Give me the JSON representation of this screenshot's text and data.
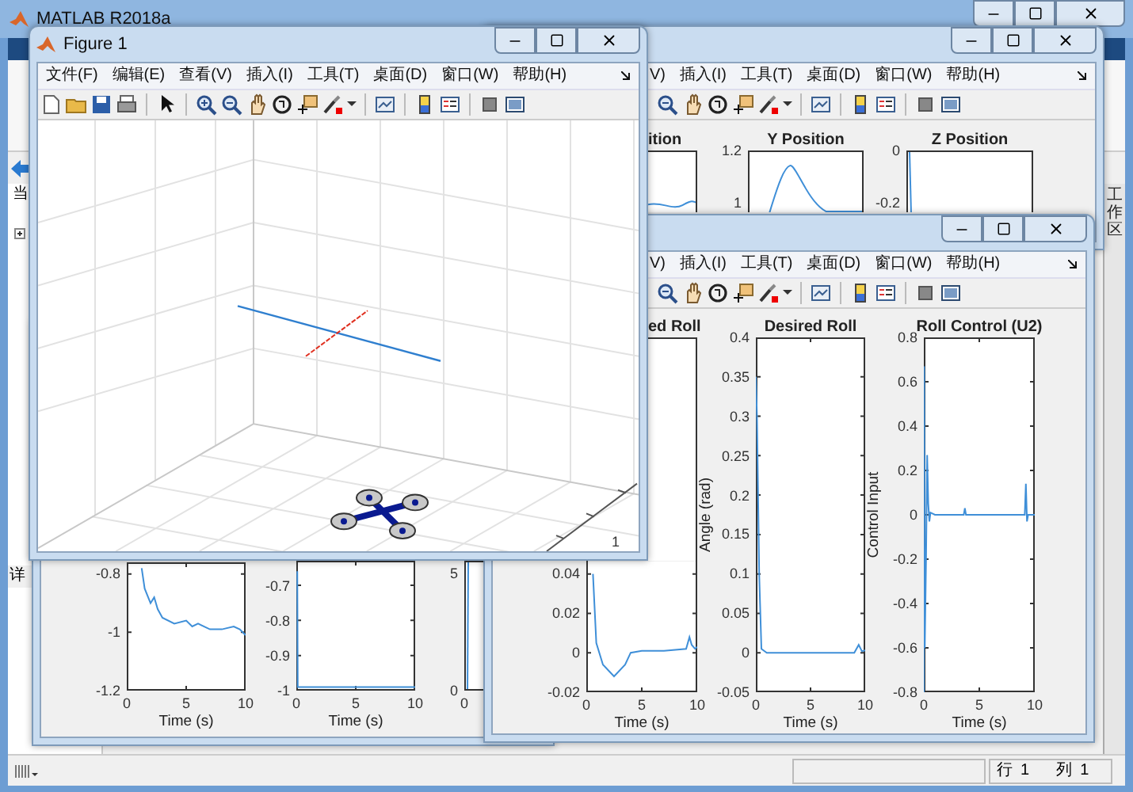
{
  "main_window": {
    "title": "MATLAB R2018a",
    "left_panel": [
      "当",
      "详"
    ],
    "workspace_tab": "工作区",
    "status_bar": {
      "row_label": "行",
      "row": "1",
      "column_label": "列",
      "column": "1"
    }
  },
  "figures": [
    {
      "title": "Figure 1",
      "menu": [
        "文件(F)",
        "编辑(E)",
        "查看(V)",
        "插入(I)",
        "工具(T)",
        "桌面(D)",
        "窗口(W)",
        "帮助(H)"
      ],
      "axis_tick": "1"
    },
    {
      "menu": [
        "V)",
        "插入(I)",
        "工具(T)",
        "桌面(D)",
        "窗口(W)",
        "帮助(H)"
      ],
      "plots": [
        {
          "chart_data": {
            "type": "line",
            "title": "ed Roll",
            "xlabel": "Time (s)",
            "x": [
              0.6,
              0.9,
              1.5,
              2.5,
              3.5,
              4,
              5,
              7,
              9,
              9.3,
              9.5,
              9.8,
              10
            ],
            "series": [
              {
                "color": "#3f8fd8",
                "values": [
                  0.04,
                  0.005,
                  -0.006,
                  -0.012,
                  -0.006,
                  0,
                  0.001,
                  0.001,
                  0.002,
                  0.008,
                  0.004,
                  0.002,
                  0.003
                ]
              }
            ],
            "xlim": [
              0,
              10
            ],
            "ylim": [
              -0.02,
              0.16
            ],
            "xticks": [
              0,
              5,
              10
            ],
            "yticks": [
              -0.02,
              0,
              0.02,
              0.04
            ]
          }
        },
        {
          "chart_data": {
            "type": "line",
            "title": "Desired Roll",
            "xlabel": "Time (s)",
            "ylabel": "Angle (rad)",
            "x": [
              0,
              0.1,
              0.3,
              0.5,
              1,
              3,
              5,
              7,
              9,
              9.4,
              9.7,
              10
            ],
            "series": [
              {
                "color": "#3f8fd8",
                "values": [
                  0.35,
                  0.3,
                  0.1,
                  0.005,
                  0,
                  0,
                  0,
                  0,
                  0,
                  0.01,
                  0.002,
                  0.003
                ]
              }
            ],
            "xlim": [
              0,
              10
            ],
            "ylim": [
              -0.05,
              0.4
            ],
            "xticks": [
              0,
              5,
              10
            ],
            "yticks": [
              -0.05,
              0,
              0.05,
              0.1,
              0.15,
              0.2,
              0.25,
              0.3,
              0.35,
              0.4
            ]
          }
        },
        {
          "chart_data": {
            "type": "line",
            "title": "Roll Control (U2)",
            "xlabel": "Time (s)",
            "ylabel": "Control Input",
            "x": [
              0,
              0.03,
              0.08,
              0.2,
              0.3,
              0.4,
              0.5,
              0.6,
              1,
              3.6,
              3.7,
              3.8,
              6,
              9.1,
              9.2,
              9.3,
              9.4,
              10
            ],
            "series": [
              {
                "color": "#3f8fd8",
                "values": [
                  -0.8,
                  0.67,
                  -0.6,
                  -0.2,
                  0.27,
                  0.05,
                  -0.03,
                  0.01,
                  0,
                  0,
                  0.03,
                  0,
                  0,
                  0,
                  0.14,
                  -0.03,
                  0,
                  0
                ]
              }
            ],
            "xlim": [
              0,
              10
            ],
            "ylim": [
              -0.8,
              0.8
            ],
            "xticks": [
              0,
              5,
              10
            ],
            "yticks": [
              -0.8,
              -0.6,
              -0.4,
              -0.2,
              0,
              0.2,
              0.4,
              0.6,
              0.8
            ]
          }
        }
      ]
    },
    {
      "plots": [
        {
          "chart_data": {
            "type": "line",
            "xlabel": "Time (s)",
            "x": [
              1.25,
              1.5,
              2,
              2.3,
              2.6,
              3,
              4,
              5,
              5.5,
              6,
              7,
              8,
              9,
              9.5,
              10
            ],
            "series": [
              {
                "color": "#3f8fd8",
                "values": [
                  -0.78,
                  -0.85,
                  -0.9,
                  -0.88,
                  -0.92,
                  -0.95,
                  -0.97,
                  -0.96,
                  -0.98,
                  -0.97,
                  -0.99,
                  -0.99,
                  -0.98,
                  -0.99,
                  -1.01
                ]
              }
            ],
            "xlim": [
              0,
              10
            ],
            "ylim": [
              -1.2,
              -0.76
            ],
            "xticks": [
              0,
              5,
              10
            ],
            "yticks": [
              -1.2,
              -1,
              -0.8
            ]
          }
        },
        {
          "chart_data": {
            "type": "line",
            "xlabel": "Time (s)",
            "x": [
              0.08,
              0.12,
              10
            ],
            "series": [
              {
                "color": "#3f8fd8",
                "values": [
                  -0.66,
                  -0.99,
                  -0.99
                ]
              }
            ],
            "xlim": [
              0,
              10
            ],
            "ylim": [
              -1,
              -0.63
            ],
            "xticks": [
              0,
              5,
              10
            ],
            "yticks": [
              -1,
              -0.9,
              -0.8,
              -0.7
            ]
          }
        },
        {
          "y_tick_labels": [
            "5",
            "0"
          ],
          "x_tick_labels": [
            "0"
          ]
        }
      ]
    },
    {
      "menu": [
        "V)",
        "插入(I)",
        "工具(T)",
        "桌面(D)",
        "窗口(W)",
        "帮助(H)"
      ],
      "plots": [
        {
          "title": "ition"
        },
        {
          "title": "Y Position",
          "y_tick_labels": [
            "1.2",
            "1"
          ]
        },
        {
          "title": "Z Position",
          "y_tick_labels": [
            "0",
            "-0.2"
          ]
        }
      ]
    }
  ]
}
